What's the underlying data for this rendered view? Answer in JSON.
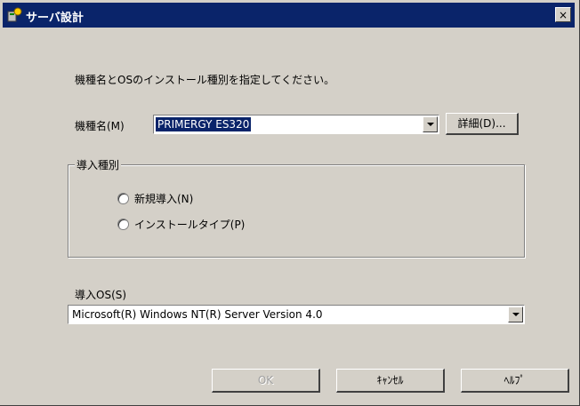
{
  "window": {
    "title": "サーバ設計",
    "close_glyph": "×"
  },
  "instruction": "機種名とOSのインストール種別を指定してください。",
  "model": {
    "label": "機種名(M)",
    "value": "PRIMERGY ES320",
    "detail_button": "詳細(D)..."
  },
  "install_type": {
    "group_title": "導入種別",
    "options": [
      {
        "label": "新規導入(N)",
        "selected": false
      },
      {
        "label": "インストールタイプ(P)",
        "selected": false
      }
    ]
  },
  "install_os": {
    "label": "導入OS(S)",
    "value": "Microsoft(R) Windows NT(R) Server Version 4.0"
  },
  "buttons": {
    "ok": "OK",
    "cancel": "ｷｬﾝｾﾙ",
    "help": "ﾍﾙﾌﾟ"
  }
}
